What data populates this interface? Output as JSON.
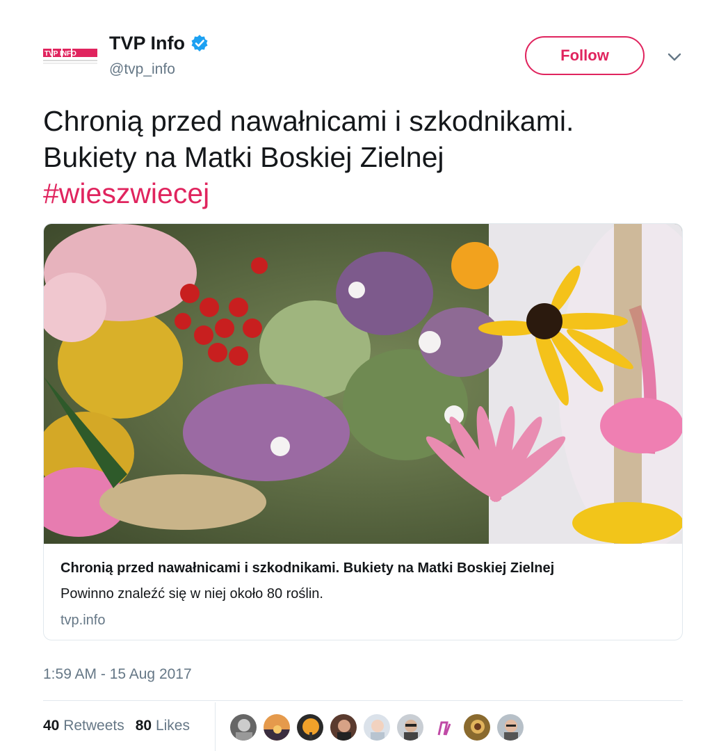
{
  "account": {
    "logo_text": "TVP INFO",
    "display_name": "TVP Info",
    "handle": "@tvp_info",
    "follow_label": "Follow",
    "accent_color": "#e0245e",
    "verified_color": "#1da1f2"
  },
  "tweet": {
    "line1": "Chronią przed nawałnicami i szkodnikami.",
    "line2": "Bukiety na Matki Boskiej Zielnej",
    "hashtag": "#wieszwiecej"
  },
  "card": {
    "title": "Chronią przed nawałnicami i szkodnikami. Bukiety na Matki Boskiej Zielnej",
    "description": "Powinno znaleźć się w niej około 80 roślin.",
    "domain": "tvp.info"
  },
  "timestamp": "1:59 AM - 15 Aug 2017",
  "stats": {
    "retweets_count": "40",
    "retweets_label": "Retweets",
    "likes_count": "80",
    "likes_label": "Likes"
  },
  "icons": {
    "verified": "verified-badge-icon",
    "caret": "chevron-down-icon"
  }
}
